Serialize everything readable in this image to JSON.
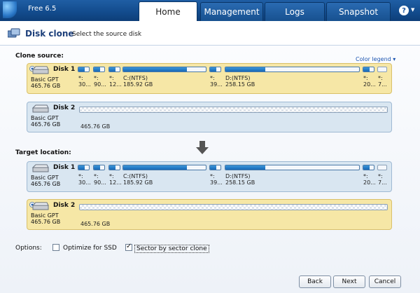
{
  "app": {
    "version": "Free 6.5"
  },
  "tabs": [
    {
      "label": "Home"
    },
    {
      "label": "Management"
    },
    {
      "label": "Logs"
    },
    {
      "label": "Snapshot"
    }
  ],
  "header": {
    "title": "Disk clone",
    "subtitle": "Select the source disk"
  },
  "source": {
    "label": "Clone source:",
    "color_legend": "Color legend",
    "disk1": {
      "name": "Disk 1",
      "type": "Basic GPT",
      "size": "465.76 GB",
      "partitions": [
        {
          "l1": "*:",
          "l2": "30...",
          "fill": 0.6
        },
        {
          "l1": "*:",
          "l2": "90...",
          "fill": 0.6
        },
        {
          "l1": "*:",
          "l2": "12...",
          "fill": 0.6
        },
        {
          "l1": "C:(NTFS)",
          "l2": "185.92 GB",
          "fill": 0.77
        },
        {
          "l1": "*:",
          "l2": "39...",
          "fill": 0.6
        },
        {
          "l1": "D:(NTFS)",
          "l2": "258.15 GB",
          "fill": 0.3
        },
        {
          "l1": "*:",
          "l2": "20...",
          "fill": 0.6
        },
        {
          "l1": "*:",
          "l2": "7...",
          "fill": 0.0
        }
      ]
    },
    "disk2": {
      "name": "Disk 2",
      "type": "Basic GPT",
      "size": "465.76 GB",
      "unallocated": "465.76 GB"
    }
  },
  "target": {
    "label": "Target location:",
    "disk1": {
      "name": "Disk 1",
      "type": "Basic GPT",
      "size": "465.76 GB",
      "partitions": [
        {
          "l1": "*:",
          "l2": "30...",
          "fill": 0.6
        },
        {
          "l1": "*:",
          "l2": "90...",
          "fill": 0.6
        },
        {
          "l1": "*:",
          "l2": "12...",
          "fill": 0.6
        },
        {
          "l1": "C:(NTFS)",
          "l2": "185.92 GB",
          "fill": 0.77
        },
        {
          "l1": "*:",
          "l2": "39...",
          "fill": 0.6
        },
        {
          "l1": "D:(NTFS)",
          "l2": "258.15 GB",
          "fill": 0.3
        },
        {
          "l1": "*:",
          "l2": "20...",
          "fill": 0.6
        },
        {
          "l1": "*:",
          "l2": "7...",
          "fill": 0.0
        }
      ]
    },
    "disk2": {
      "name": "Disk 2",
      "type": "Basic GPT",
      "size": "465.76 GB",
      "unallocated": "465.76 GB"
    }
  },
  "options": {
    "label": "Options:",
    "optimize_ssd": {
      "label": "Optimize for SSD",
      "checked": false
    },
    "sector_clone": {
      "label": "Sector by sector clone",
      "checked": true
    }
  },
  "buttons": {
    "back": "Back",
    "next": "Next",
    "cancel": "Cancel"
  },
  "colors": {
    "selected_row": "#f6e7a6",
    "normal_row": "#d9e6f1",
    "used_fill": "#1768b8",
    "topbar": "#134c8e"
  }
}
